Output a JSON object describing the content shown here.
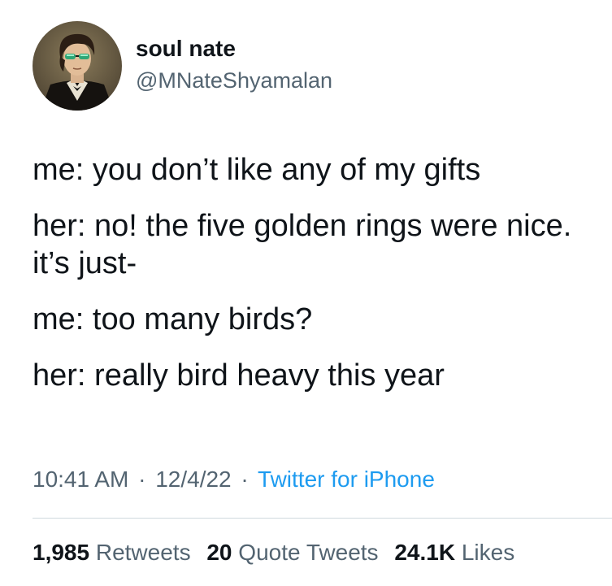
{
  "author": {
    "display_name": "soul nate",
    "handle": "@MNateShyamalan",
    "avatar_icon": "portrait-avatar-with-sunglasses"
  },
  "tweet": {
    "lines": [
      "me: you don’t like any of my gifts",
      "her: no! the five golden rings were nice. it’s just-",
      "me: too many birds?",
      "her: really bird heavy this year"
    ]
  },
  "meta": {
    "time": "10:41 AM",
    "date": "12/4/22",
    "separator": "·",
    "source": "Twitter for iPhone"
  },
  "stats": {
    "retweets_count": "1,985",
    "retweets_label": "Retweets",
    "quotes_count": "20",
    "quotes_label": "Quote Tweets",
    "likes_count": "24.1K",
    "likes_label": "Likes"
  },
  "colors": {
    "text": "#0f1419",
    "secondary": "#536471",
    "link": "#1d9bf0",
    "divider": "#cfd9de"
  }
}
